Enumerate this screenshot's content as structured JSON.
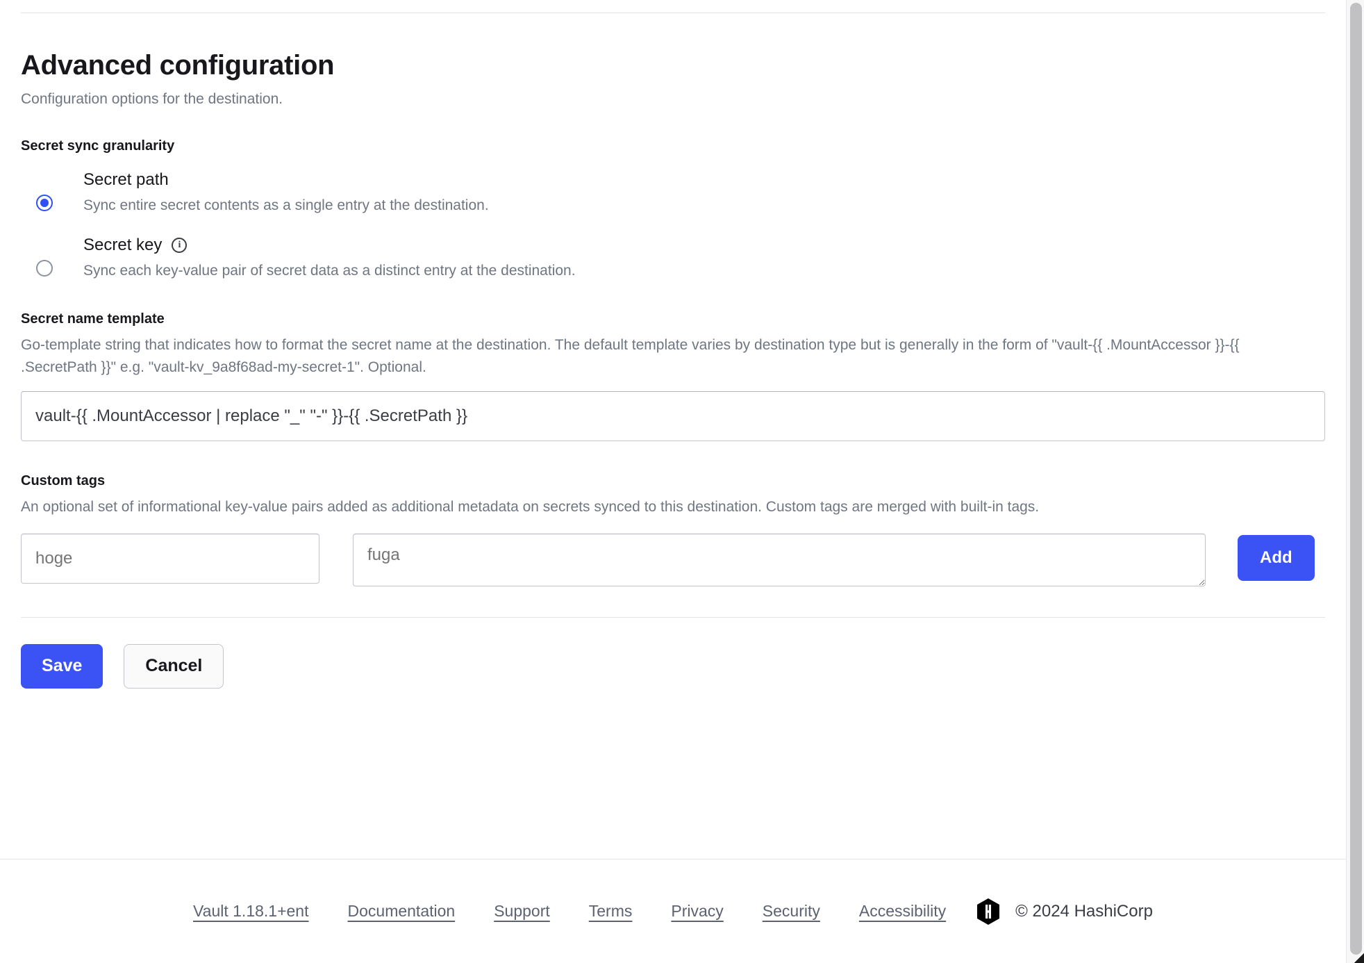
{
  "page": {
    "title": "Advanced configuration",
    "subtitle": "Configuration options for the destination."
  },
  "granularity": {
    "label": "Secret sync granularity",
    "options": [
      {
        "id": "secret-path",
        "title": "Secret path",
        "description": "Sync entire secret contents as a single entry at the destination.",
        "selected": true,
        "has_info_icon": false,
        "info_icon": ""
      },
      {
        "id": "secret-key",
        "title": "Secret key",
        "description": "Sync each key-value pair of secret data as a distinct entry at the destination.",
        "selected": false,
        "has_info_icon": true,
        "info_icon": "info-icon",
        "info_glyph": "i"
      }
    ]
  },
  "secret_name_template": {
    "label": "Secret name template",
    "help": "Go-template string that indicates how to format the secret name at the destination. The default template varies by destination type but is generally in the form of \"vault-{{ .MountAccessor }}-{{ .SecretPath }}\" e.g. \"vault-kv_9a8f68ad-my-secret-1\". Optional.",
    "value": "vault-{{ .MountAccessor | replace \"_\" \"-\" }}-{{ .SecretPath }}",
    "placeholder": ""
  },
  "custom_tags": {
    "label": "Custom tags",
    "help": "An optional set of informational key-value pairs added as additional metadata on secrets synced to this destination. Custom tags are merged with built-in tags.",
    "key_value": "",
    "key_placeholder": "hoge",
    "value_value": "",
    "value_placeholder": "fuga",
    "add_label": "Add"
  },
  "actions": {
    "save_label": "Save",
    "cancel_label": "Cancel"
  },
  "footer": {
    "links": [
      "Vault 1.18.1+ent",
      "Documentation",
      "Support",
      "Terms",
      "Privacy",
      "Security",
      "Accessibility"
    ],
    "copyright": "© 2024 HashiCorp",
    "logo_name": "hashicorp-logo-icon"
  },
  "colors": {
    "accent": "#3b53f5",
    "radio_selected": "#2f50f5",
    "text_primary": "#17171c",
    "text_muted": "#6f7682",
    "border": "#c2c5cb",
    "rule": "#e4e4e7"
  }
}
